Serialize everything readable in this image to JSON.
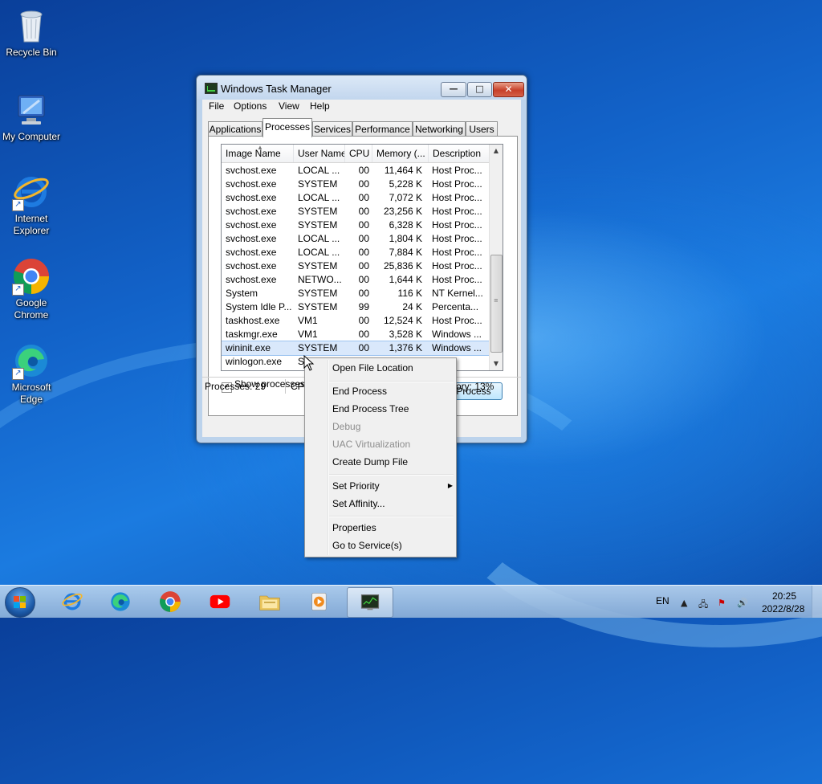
{
  "desktop": {
    "icons": [
      {
        "label": "Recycle Bin"
      },
      {
        "label": "My Computer"
      },
      {
        "label": "Internet Explorer"
      },
      {
        "label": "Google Chrome"
      },
      {
        "label": "Microsoft Edge"
      }
    ]
  },
  "window": {
    "title": "Windows Task Manager",
    "caption": {
      "minimize": "—",
      "maximize": "□",
      "close": "✕"
    },
    "menu": [
      "File",
      "Options",
      "View",
      "Help"
    ],
    "tabs": [
      "Applications",
      "Processes",
      "Services",
      "Performance",
      "Networking",
      "Users"
    ],
    "active_tab": "Processes",
    "columns": [
      "Image Name",
      "User Name",
      "CPU",
      "Memory (...",
      "Description"
    ],
    "processes": [
      {
        "name": "svchost.exe",
        "user": "LOCAL ...",
        "cpu": "00",
        "mem": "11,464 K",
        "desc": "Host Proc..."
      },
      {
        "name": "svchost.exe",
        "user": "SYSTEM",
        "cpu": "00",
        "mem": "5,228 K",
        "desc": "Host Proc..."
      },
      {
        "name": "svchost.exe",
        "user": "LOCAL ...",
        "cpu": "00",
        "mem": "7,072 K",
        "desc": "Host Proc..."
      },
      {
        "name": "svchost.exe",
        "user": "SYSTEM",
        "cpu": "00",
        "mem": "23,256 K",
        "desc": "Host Proc..."
      },
      {
        "name": "svchost.exe",
        "user": "SYSTEM",
        "cpu": "00",
        "mem": "6,328 K",
        "desc": "Host Proc..."
      },
      {
        "name": "svchost.exe",
        "user": "LOCAL ...",
        "cpu": "00",
        "mem": "1,804 K",
        "desc": "Host Proc..."
      },
      {
        "name": "svchost.exe",
        "user": "LOCAL ...",
        "cpu": "00",
        "mem": "7,884 K",
        "desc": "Host Proc..."
      },
      {
        "name": "svchost.exe",
        "user": "SYSTEM",
        "cpu": "00",
        "mem": "25,836 K",
        "desc": "Host Proc..."
      },
      {
        "name": "svchost.exe",
        "user": "NETWO...",
        "cpu": "00",
        "mem": "1,644 K",
        "desc": "Host Proc..."
      },
      {
        "name": "System",
        "user": "SYSTEM",
        "cpu": "00",
        "mem": "116 K",
        "desc": "NT Kernel..."
      },
      {
        "name": "System Idle P...",
        "user": "SYSTEM",
        "cpu": "99",
        "mem": "24 K",
        "desc": "Percenta..."
      },
      {
        "name": "taskhost.exe",
        "user": "VM1",
        "cpu": "00",
        "mem": "12,524 K",
        "desc": "Host Proc..."
      },
      {
        "name": "taskmgr.exe",
        "user": "VM1",
        "cpu": "00",
        "mem": "3,528 K",
        "desc": "Windows ..."
      },
      {
        "name": "wininit.exe",
        "user": "SYSTEM",
        "cpu": "00",
        "mem": "1,376 K",
        "desc": "Windows ..."
      },
      {
        "name": "winlogon.exe",
        "user": "S",
        "cpu": "",
        "mem": "",
        "desc": "ws ..."
      }
    ],
    "selected_index": 13,
    "show_all_label": "Show processes fr",
    "end_process_label": "Process",
    "status": {
      "processes": "Processes: 29",
      "cpu": "CPU",
      "memory": "ory: 13%"
    }
  },
  "context_menu": {
    "items": [
      {
        "label": "Open File Location",
        "disabled": false
      },
      {
        "label": "End Process",
        "disabled": false
      },
      {
        "label": "End Process Tree",
        "disabled": false
      },
      {
        "label": "Debug",
        "disabled": true
      },
      {
        "label": "UAC Virtualization",
        "disabled": true
      },
      {
        "label": "Create Dump File",
        "disabled": false
      },
      {
        "label": "Set Priority",
        "disabled": false,
        "submenu": true
      },
      {
        "label": "Set Affinity...",
        "disabled": false
      },
      {
        "label": "Properties",
        "disabled": false
      },
      {
        "label": "Go to Service(s)",
        "disabled": false
      }
    ]
  },
  "taskbar": {
    "pinned": [
      "start-button",
      "internet-explorer",
      "microsoft-edge",
      "google-chrome",
      "youtube",
      "file-explorer",
      "media-player",
      "task-manager"
    ],
    "tray": {
      "language": "EN",
      "time": "20:25",
      "date": "2022/8/28"
    }
  },
  "colors": {
    "desktop_blue": "#1262c8",
    "selection": "#d9e8fb",
    "taskbar": "#a9c4e4"
  }
}
